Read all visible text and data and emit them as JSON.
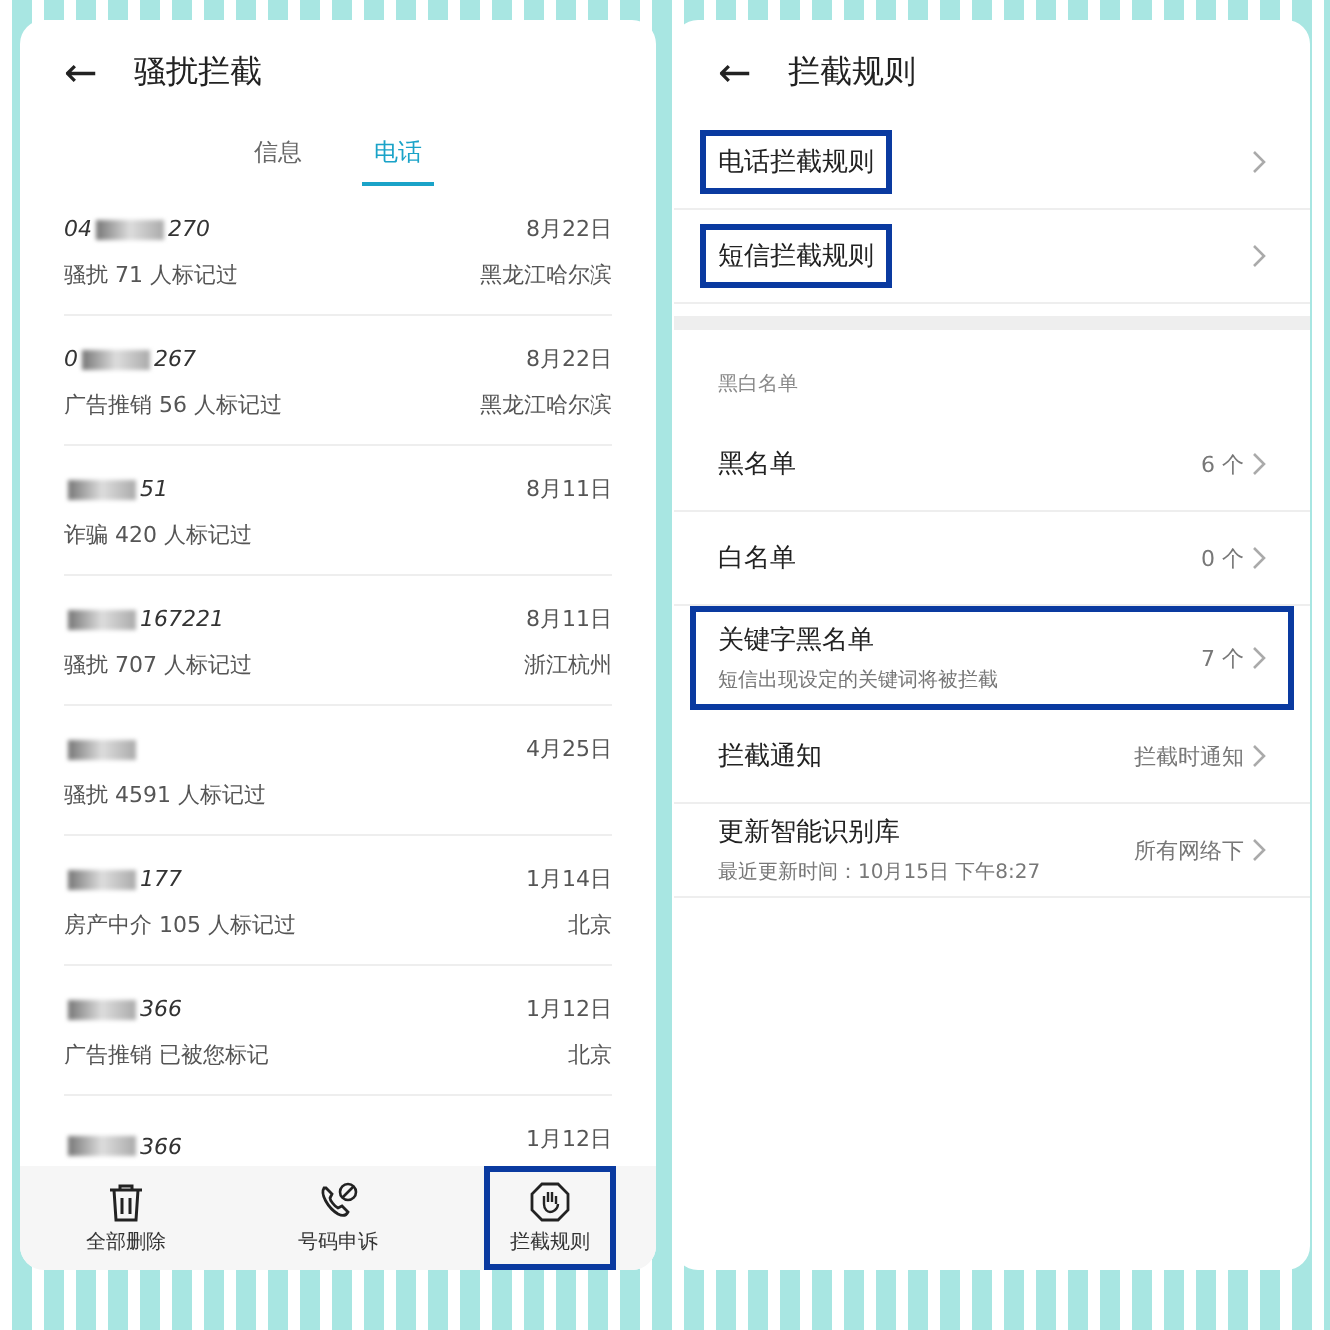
{
  "left": {
    "title": "骚扰拦截",
    "back": "←",
    "tabs": [
      {
        "label": "信息",
        "selected": false
      },
      {
        "label": "电话",
        "selected": true
      }
    ],
    "calls": [
      {
        "prefix": "04",
        "suffix": "270",
        "date": "8月22日",
        "tag": "骚扰 71 人标记过",
        "location": "黑龙江哈尔滨"
      },
      {
        "prefix": "0",
        "suffix": "267",
        "date": "8月22日",
        "tag": "广告推销 56 人标记过",
        "location": "黑龙江哈尔滨"
      },
      {
        "suffix": "51",
        "date": "8月11日",
        "tag": "诈骗 420 人标记过"
      },
      {
        "suffix": "167221",
        "date": "8月11日",
        "tag": "骚扰 707 人标记过",
        "location": "浙江杭州"
      },
      {
        "date": "4月25日",
        "tag": "骚扰 4591 人标记过"
      },
      {
        "suffix": "177",
        "date": "1月14日",
        "tag": "房产中介 105 人标记过",
        "location": "北京"
      },
      {
        "suffix": "366",
        "date": "1月12日",
        "tag": "广告推销 已被您标记",
        "location": "北京"
      },
      {
        "suffix": "366",
        "date": "1月12日"
      }
    ],
    "actions": [
      {
        "kind": "trash",
        "label": "全部删除",
        "highlighted": false
      },
      {
        "kind": "phone",
        "label": "号码申诉",
        "highlighted": false
      },
      {
        "kind": "hand",
        "label": "拦截规则",
        "highlighted": true
      }
    ]
  },
  "right": {
    "title": "拦截规则",
    "back": "←",
    "rules": [
      {
        "label": "电话拦截规则",
        "highlighted": true
      },
      {
        "label": "短信拦截规则",
        "highlighted": true
      }
    ],
    "section": "黑白名单",
    "lists": [
      {
        "label": "黑名单",
        "value": "6 个",
        "highlighted": false
      },
      {
        "label": "白名单",
        "value": "0 个",
        "highlighted": false
      },
      {
        "label": "关键字黑名单",
        "sub": "短信出现设定的关键词将被拦截",
        "value": "7 个",
        "highlighted": true
      },
      {
        "label": "拦截通知",
        "value": "拦截时通知",
        "highlighted": false
      },
      {
        "label": "更新智能识别库",
        "sub": "最近更新时间：10月15日 下午8:27",
        "value": "所有网络下",
        "highlighted": false
      }
    ]
  }
}
